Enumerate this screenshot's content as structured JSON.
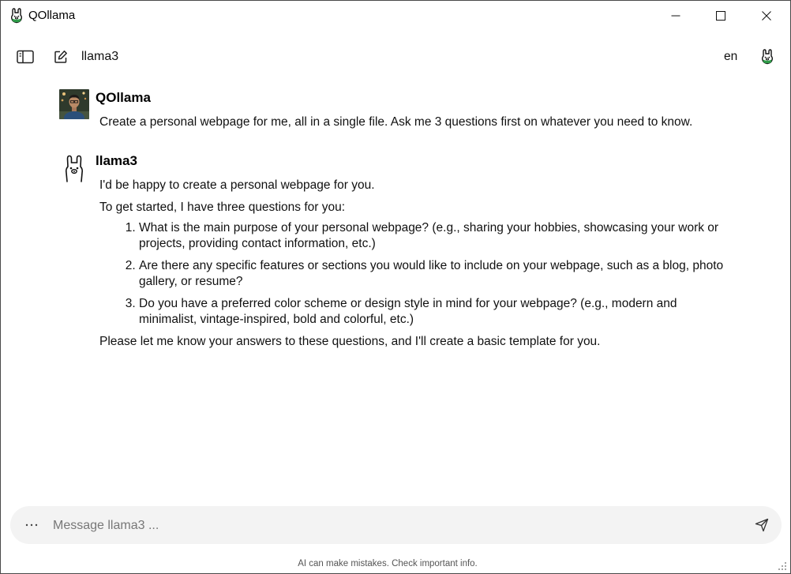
{
  "window": {
    "title": "QOllama",
    "icon": "llama-logo-icon"
  },
  "toolbar": {
    "model_name": "llama3",
    "language": "en",
    "icons": [
      "sidebar-toggle-icon",
      "new-chat-icon",
      "llama-logo-icon"
    ]
  },
  "messages": [
    {
      "sender": "QOllama",
      "avatar": "user-photo",
      "text": "Create a personal webpage for me, all in a single file. Ask me 3 questions first on whatever you need to know."
    },
    {
      "sender": "llama3",
      "avatar": "llama-avatar-icon",
      "intro": "I'd be happy to create a personal webpage for you.",
      "lead": "To get started, I have three questions for you:",
      "questions": [
        "What is the main purpose of your personal webpage? (e.g., sharing your hobbies, showcasing your work or projects, providing contact information, etc.)",
        "Are there any specific features or sections you would like to include on your webpage, such as a blog, photo gallery, or resume?",
        "Do you have a preferred color scheme or design style in mind for your webpage? (e.g., modern and minimalist, vintage-inspired, bold and colorful, etc.)"
      ],
      "closing": "Please let me know your answers to these questions, and I'll create a basic template for you."
    }
  ],
  "input": {
    "placeholder": "Message llama3 ...",
    "value": ""
  },
  "footer": {
    "disclaimer": "AI can make mistakes. Check important info."
  },
  "colors": {
    "accent_green": "#2e9b48",
    "input_bg": "#f3f3f3"
  }
}
